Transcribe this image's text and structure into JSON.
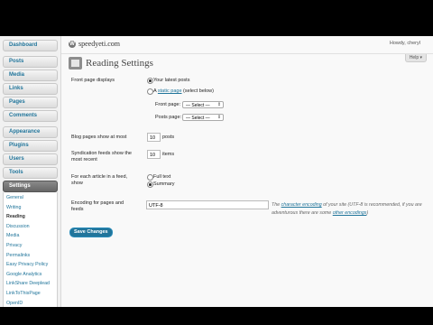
{
  "sidebar": {
    "dashboard": "Dashboard",
    "group1": [
      "Posts",
      "Media",
      "Links",
      "Pages",
      "Comments"
    ],
    "group2": [
      "Appearance",
      "Plugins",
      "Users",
      "Tools",
      "Settings"
    ],
    "submenu": [
      "General",
      "Writing",
      "Reading",
      "Discussion",
      "Media",
      "Privacy",
      "Permalinks",
      "Easy Privacy Policy",
      "Google Analytics",
      "LinkShare Deeplead",
      "LinkToThisPage",
      "OpenID"
    ]
  },
  "header": {
    "site_name": "speedyeti.com",
    "howdy": "Howdy, cheryl",
    "help": "Help ▾"
  },
  "page": {
    "title": "Reading Settings",
    "front_page_label": "Front page displays",
    "opt_latest_posts": "Your latest posts",
    "opt_static_prefix": "A ",
    "opt_static_link": "static page",
    "opt_static_suffix": " (select below)",
    "front_page_select_label": "Front page:",
    "posts_page_select_label": "Posts page:",
    "select_placeholder": "— Select —",
    "blog_pages_label": "Blog pages show at most",
    "blog_pages_value": "10",
    "blog_pages_suffix": "posts",
    "syndication_label": "Syndication feeds show the most recent",
    "syndication_value": "10",
    "syndication_suffix": "items",
    "feed_label": "For each article in a feed, show",
    "feed_full": "Full text",
    "feed_summary": "Summary",
    "encoding_label": "Encoding for pages and feeds",
    "encoding_value": "UTF-8",
    "encoding_desc_1": "The ",
    "encoding_desc_link1": "character encoding",
    "encoding_desc_2": " of your site (UTF-8 is recommended, if you are adventurous there are some ",
    "encoding_desc_link2": "other encodings",
    "encoding_desc_3": ")",
    "save_label": "Save Changes"
  }
}
